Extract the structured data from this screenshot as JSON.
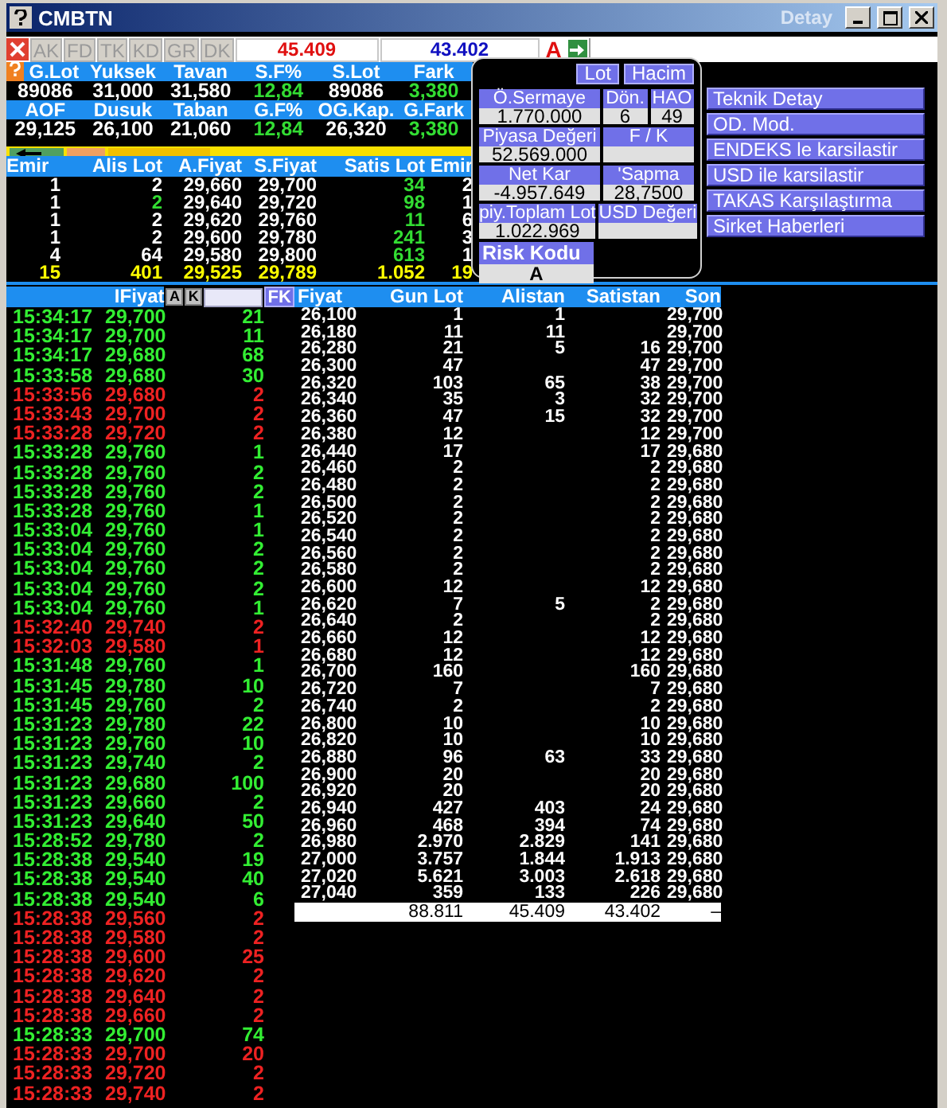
{
  "window": {
    "title": "CMBTN",
    "detail_label": "Detay"
  },
  "toolbar": {
    "buttons": [
      {
        "label": "AK",
        "disabled": true
      },
      {
        "label": "FD",
        "disabled": true
      },
      {
        "label": "TK",
        "disabled": true
      },
      {
        "label": "KD",
        "disabled": true
      },
      {
        "label": "GR",
        "disabled": true
      },
      {
        "label": "DK",
        "disabled": true
      }
    ],
    "bid_total": "45.409",
    "ask_total": "43.402",
    "mode": "A"
  },
  "stats": [
    [
      {
        "label": "G.Lot",
        "value": "89086",
        "positive": false
      },
      {
        "label": "Yuksek",
        "value": "31,000",
        "positive": false
      },
      {
        "label": "Tavan",
        "value": "31,580",
        "positive": false
      },
      {
        "label": "S.F%",
        "value": "12,84",
        "positive": true
      },
      {
        "label": "S.Lot",
        "value": "89086",
        "positive": false
      },
      {
        "label": "Fark",
        "value": "3,380",
        "positive": true
      }
    ],
    [
      {
        "label": "AOF",
        "value": "29,125",
        "positive": false
      },
      {
        "label": "Dusuk",
        "value": "26,100",
        "positive": false
      },
      {
        "label": "Taban",
        "value": "21,060",
        "positive": false
      },
      {
        "label": "G.F%",
        "value": "12,84",
        "positive": true
      },
      {
        "label": "OG.Kap.",
        "value": "26,320",
        "positive": false
      },
      {
        "label": "G.Fark",
        "value": "3,380",
        "positive": true
      }
    ]
  ],
  "order_book": {
    "columns": [
      "Emir",
      "Alis Lot",
      "A.Fiyat",
      "S.Fiyat",
      "Satis Lot",
      "Emir"
    ],
    "rows": [
      {
        "kind": "level",
        "alis_highlight": false,
        "cells": [
          "1",
          "2",
          "29,660",
          "29,700",
          "34",
          "2"
        ]
      },
      {
        "kind": "level",
        "alis_highlight": true,
        "cells": [
          "1",
          "2",
          "29,640",
          "29,720",
          "98",
          "1"
        ]
      },
      {
        "kind": "level",
        "alis_highlight": false,
        "cells": [
          "1",
          "2",
          "29,620",
          "29,760",
          "11",
          "6"
        ]
      },
      {
        "kind": "level",
        "alis_highlight": false,
        "cells": [
          "1",
          "2",
          "29,600",
          "29,780",
          "241",
          "3"
        ]
      },
      {
        "kind": "level",
        "alis_highlight": false,
        "cells": [
          "4",
          "64",
          "29,580",
          "29,800",
          "613",
          "1"
        ]
      },
      {
        "kind": "total",
        "alis_highlight": false,
        "cells": [
          "15",
          "401",
          "29,525",
          "29,789",
          "1.052",
          "19"
        ]
      }
    ]
  },
  "popup": {
    "buttons": [
      "Lot",
      "Hacim"
    ],
    "rows": [
      [
        {
          "label": "Ö.Sermaye",
          "value": "1.770.000"
        },
        {
          "label": "Dön.",
          "value": "6"
        },
        {
          "label": "HAO",
          "value": "49"
        }
      ],
      [
        {
          "label": "Piyasa Değeri",
          "value": "52.569.000"
        },
        {
          "label": "F / K"
        }
      ],
      [
        {
          "label": "Net Kar",
          "value": "-4.957.649"
        },
        {
          "label": "'Sapma",
          "value": "28,7500"
        }
      ],
      [
        {
          "label": "piy.Toplam Lot",
          "value": "1.022.969"
        },
        {
          "label": "USD Değeri"
        }
      ]
    ],
    "risk": {
      "label": "Risk Kodu",
      "value": "A"
    }
  },
  "side_buttons": [
    "Teknik Detay",
    "OD. Mod.",
    "ENDEKS le karsilastir",
    "USD ile karsilastir",
    "TAKAS Karşılaştırma",
    "Sirket Haberleri"
  ],
  "trades": {
    "header": {
      "label": "IFiyat",
      "buttons": [
        "A",
        "K"
      ],
      "filter_button": "FK"
    },
    "rows": [
      {
        "time": "15:34:17",
        "price": "29,700",
        "lot": "21",
        "color": "#33ee33"
      },
      {
        "time": "15:34:17",
        "price": "29,700",
        "lot": "11",
        "color": "#33ee33"
      },
      {
        "time": "15:34:17",
        "price": "29,680",
        "lot": "68",
        "color": "#33ee33"
      },
      {
        "time": "15:33:58",
        "price": "29,680",
        "lot": "30",
        "color": "#33ee33"
      },
      {
        "time": "15:33:56",
        "price": "29,680",
        "lot": "2",
        "color": "#ee2222"
      },
      {
        "time": "15:33:43",
        "price": "29,700",
        "lot": "2",
        "color": "#ee2222"
      },
      {
        "time": "15:33:28",
        "price": "29,720",
        "lot": "2",
        "color": "#ee2222"
      },
      {
        "time": "15:33:28",
        "price": "29,760",
        "lot": "1",
        "color": "#33ee33"
      },
      {
        "time": "15:33:28",
        "price": "29,760",
        "lot": "2",
        "color": "#33ee33"
      },
      {
        "time": "15:33:28",
        "price": "29,760",
        "lot": "2",
        "color": "#33ee33"
      },
      {
        "time": "15:33:28",
        "price": "29,760",
        "lot": "1",
        "color": "#33ee33"
      },
      {
        "time": "15:33:04",
        "price": "29,760",
        "lot": "1",
        "color": "#33ee33"
      },
      {
        "time": "15:33:04",
        "price": "29,760",
        "lot": "2",
        "color": "#33ee33"
      },
      {
        "time": "15:33:04",
        "price": "29,760",
        "lot": "2",
        "color": "#33ee33"
      },
      {
        "time": "15:33:04",
        "price": "29,760",
        "lot": "2",
        "color": "#33ee33"
      },
      {
        "time": "15:33:04",
        "price": "29,760",
        "lot": "1",
        "color": "#33ee33"
      },
      {
        "time": "15:32:40",
        "price": "29,740",
        "lot": "2",
        "color": "#ee2222"
      },
      {
        "time": "15:32:03",
        "price": "29,580",
        "lot": "1",
        "color": "#ee2222"
      },
      {
        "time": "15:31:48",
        "price": "29,760",
        "lot": "1",
        "color": "#33ee33"
      },
      {
        "time": "15:31:45",
        "price": "29,780",
        "lot": "10",
        "color": "#33ee33"
      },
      {
        "time": "15:31:45",
        "price": "29,760",
        "lot": "2",
        "color": "#33ee33"
      },
      {
        "time": "15:31:23",
        "price": "29,780",
        "lot": "22",
        "color": "#33ee33"
      },
      {
        "time": "15:31:23",
        "price": "29,760",
        "lot": "10",
        "color": "#33ee33"
      },
      {
        "time": "15:31:23",
        "price": "29,740",
        "lot": "2",
        "color": "#33ee33"
      },
      {
        "time": "15:31:23",
        "price": "29,680",
        "lot": "100",
        "color": "#33ee33"
      },
      {
        "time": "15:31:23",
        "price": "29,660",
        "lot": "2",
        "color": "#33ee33"
      },
      {
        "time": "15:31:23",
        "price": "29,640",
        "lot": "50",
        "color": "#33ee33"
      },
      {
        "time": "15:28:52",
        "price": "29,780",
        "lot": "2",
        "color": "#33ee33"
      },
      {
        "time": "15:28:38",
        "price": "29,540",
        "lot": "19",
        "color": "#33ee33"
      },
      {
        "time": "15:28:38",
        "price": "29,540",
        "lot": "40",
        "color": "#33ee33"
      },
      {
        "time": "15:28:38",
        "price": "29,540",
        "lot": "6",
        "color": "#33ee33"
      },
      {
        "time": "15:28:38",
        "price": "29,560",
        "lot": "2",
        "color": "#ee2222"
      },
      {
        "time": "15:28:38",
        "price": "29,580",
        "lot": "2",
        "color": "#ee2222"
      },
      {
        "time": "15:28:38",
        "price": "29,600",
        "lot": "25",
        "color": "#ee2222"
      },
      {
        "time": "15:28:38",
        "price": "29,620",
        "lot": "2",
        "color": "#ee2222"
      },
      {
        "time": "15:28:38",
        "price": "29,640",
        "lot": "2",
        "color": "#ee2222"
      },
      {
        "time": "15:28:38",
        "price": "29,660",
        "lot": "2",
        "color": "#ee2222"
      },
      {
        "time": "15:28:33",
        "price": "29,700",
        "lot": "74",
        "color": "#33ee33"
      },
      {
        "time": "15:28:33",
        "price": "29,700",
        "lot": "20",
        "color": "#ee2222"
      },
      {
        "time": "15:28:33",
        "price": "29,720",
        "lot": "2",
        "color": "#ee2222"
      },
      {
        "time": "15:28:33",
        "price": "29,740",
        "lot": "2",
        "color": "#ee2222"
      }
    ]
  },
  "price_table": {
    "columns": [
      "Fiyat",
      "Gun Lot",
      "Alistan",
      "Satistan",
      "Son"
    ],
    "rows": [
      {
        "price": "26,100",
        "day_lot": "1",
        "bid": "1",
        "last": "29,700"
      },
      {
        "price": "26,180",
        "day_lot": "11",
        "bid": "11",
        "last": "29,700"
      },
      {
        "price": "26,280",
        "day_lot": "21",
        "bid": "5",
        "ask": "16",
        "last": "29,700"
      },
      {
        "price": "26,300",
        "day_lot": "47",
        "ask": "47",
        "last": "29,700"
      },
      {
        "price": "26,320",
        "day_lot": "103",
        "bid": "65",
        "ask": "38",
        "last": "29,700"
      },
      {
        "price": "26,340",
        "day_lot": "35",
        "bid": "3",
        "ask": "32",
        "last": "29,700"
      },
      {
        "price": "26,360",
        "day_lot": "47",
        "bid": "15",
        "ask": "32",
        "last": "29,700"
      },
      {
        "price": "26,380",
        "day_lot": "12",
        "ask": "12",
        "last": "29,700"
      },
      {
        "price": "26,440",
        "day_lot": "17",
        "ask": "17",
        "last": "29,680"
      },
      {
        "price": "26,460",
        "day_lot": "2",
        "ask": "2",
        "last": "29,680"
      },
      {
        "price": "26,480",
        "day_lot": "2",
        "ask": "2",
        "last": "29,680"
      },
      {
        "price": "26,500",
        "day_lot": "2",
        "ask": "2",
        "last": "29,680"
      },
      {
        "price": "26,520",
        "day_lot": "2",
        "ask": "2",
        "last": "29,680"
      },
      {
        "price": "26,540",
        "day_lot": "2",
        "ask": "2",
        "last": "29,680"
      },
      {
        "price": "26,560",
        "day_lot": "2",
        "ask": "2",
        "last": "29,680"
      },
      {
        "price": "26,580",
        "day_lot": "2",
        "ask": "2",
        "last": "29,680"
      },
      {
        "price": "26,600",
        "day_lot": "12",
        "ask": "12",
        "last": "29,680"
      },
      {
        "price": "26,620",
        "day_lot": "7",
        "bid": "5",
        "ask": "2",
        "last": "29,680"
      },
      {
        "price": "26,640",
        "day_lot": "2",
        "ask": "2",
        "last": "29,680"
      },
      {
        "price": "26,660",
        "day_lot": "12",
        "ask": "12",
        "last": "29,680"
      },
      {
        "price": "26,680",
        "day_lot": "12",
        "ask": "12",
        "last": "29,680"
      },
      {
        "price": "26,700",
        "day_lot": "160",
        "ask": "160",
        "last": "29,680"
      },
      {
        "price": "26,720",
        "day_lot": "7",
        "ask": "7",
        "last": "29,680"
      },
      {
        "price": "26,740",
        "day_lot": "2",
        "ask": "2",
        "last": "29,680"
      },
      {
        "price": "26,800",
        "day_lot": "10",
        "ask": "10",
        "last": "29,680"
      },
      {
        "price": "26,820",
        "day_lot": "10",
        "ask": "10",
        "last": "29,680"
      },
      {
        "price": "26,880",
        "day_lot": "96",
        "bid": "63",
        "ask": "33",
        "last": "29,680"
      },
      {
        "price": "26,900",
        "day_lot": "20",
        "ask": "20",
        "last": "29,680"
      },
      {
        "price": "26,920",
        "day_lot": "20",
        "ask": "20",
        "last": "29,680"
      },
      {
        "price": "26,940",
        "day_lot": "427",
        "bid": "403",
        "ask": "24",
        "last": "29,680"
      },
      {
        "price": "26,960",
        "day_lot": "468",
        "bid": "394",
        "ask": "74",
        "last": "29,680"
      },
      {
        "price": "26,980",
        "day_lot": "2.970",
        "bid": "2.829",
        "ask": "141",
        "last": "29,680"
      },
      {
        "price": "27,000",
        "day_lot": "3.757",
        "bid": "1.844",
        "ask": "1.913",
        "last": "29,680"
      },
      {
        "price": "27,020",
        "day_lot": "5.621",
        "bid": "3.003",
        "ask": "2.618",
        "last": "29,680"
      },
      {
        "price": "27,040",
        "day_lot": "359",
        "bid": "133",
        "ask": "226",
        "last": "29,680"
      }
    ],
    "total": {
      "day_lot": "88.811",
      "bid": "45.409",
      "ask": "43.402",
      "last": "–"
    }
  }
}
